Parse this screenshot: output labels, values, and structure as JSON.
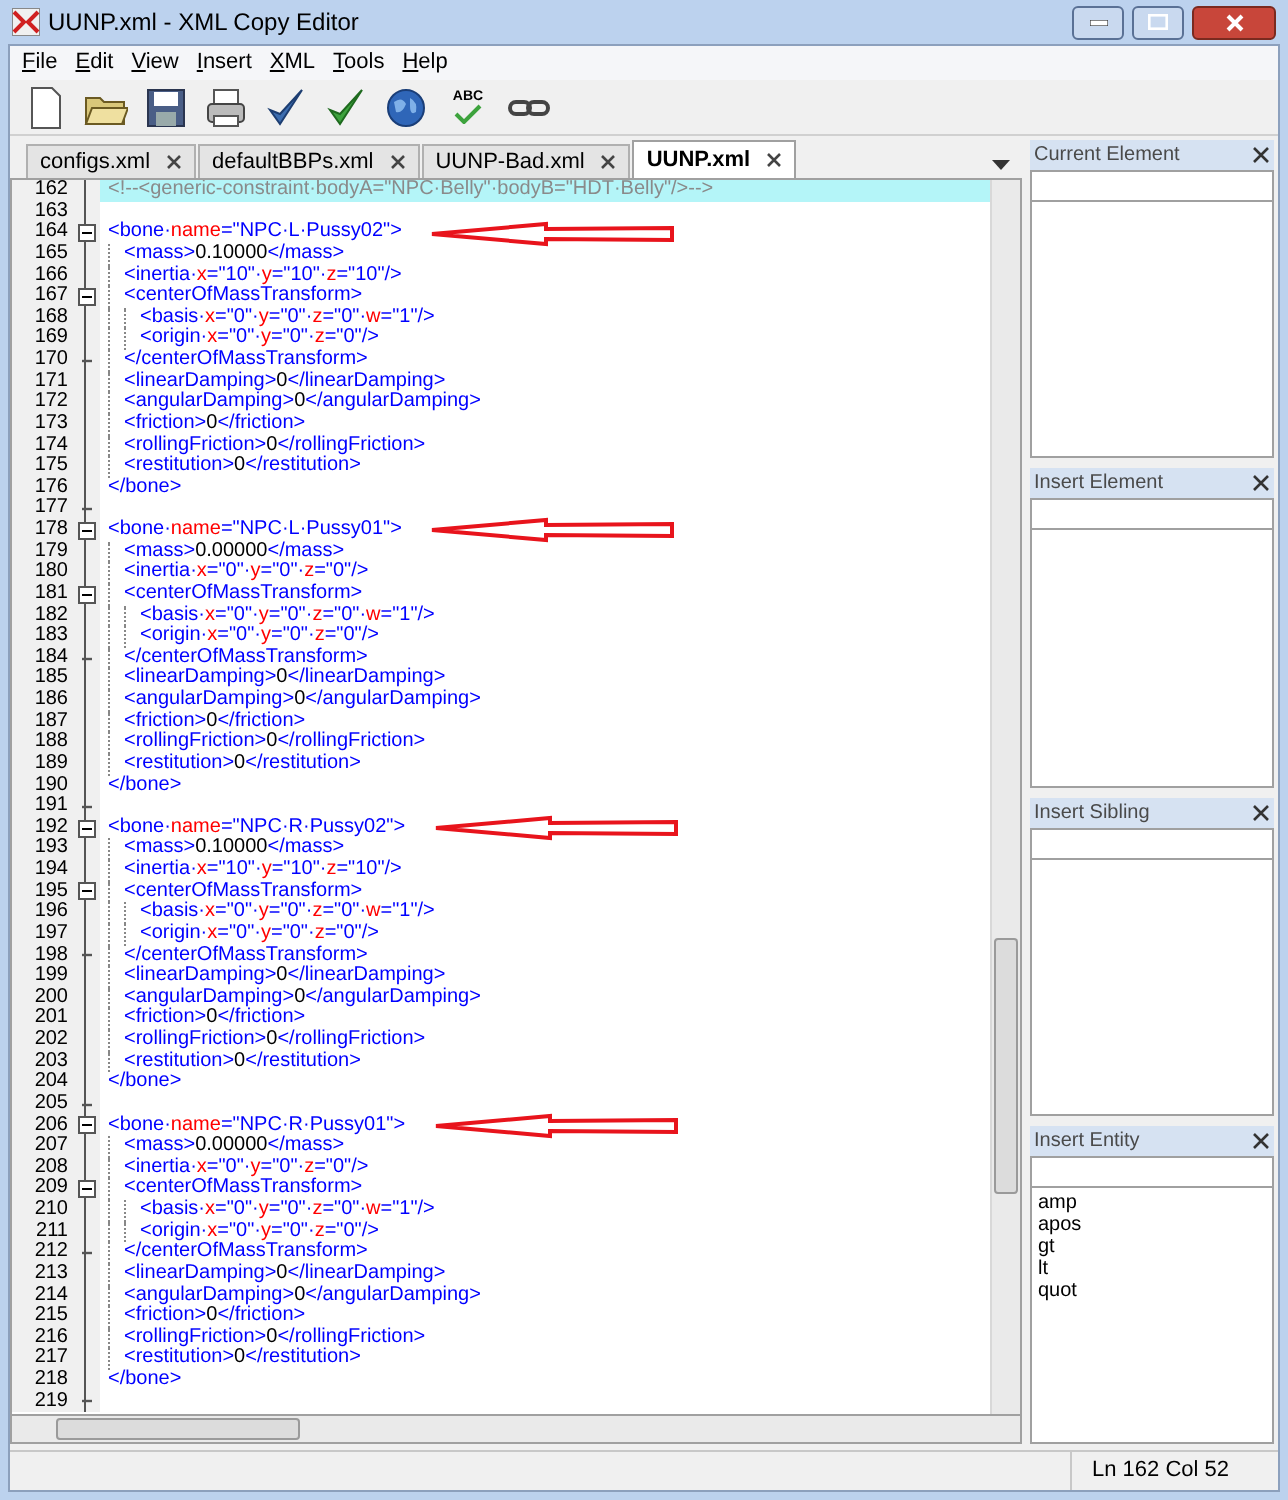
{
  "window": {
    "title": "UUNP.xml - XML Copy Editor"
  },
  "menu": [
    {
      "label": "File"
    },
    {
      "label": "Edit"
    },
    {
      "label": "View"
    },
    {
      "label": "Insert"
    },
    {
      "label": "XML"
    },
    {
      "label": "Tools"
    },
    {
      "label": "Help"
    }
  ],
  "toolbar": [
    {
      "kind": "new"
    },
    {
      "kind": "open"
    },
    {
      "kind": "save"
    },
    {
      "kind": "print"
    },
    {
      "kind": "validate"
    },
    {
      "kind": "wellformed"
    },
    {
      "kind": "globe"
    },
    {
      "kind": "spell",
      "label": "ABC"
    },
    {
      "kind": "link"
    }
  ],
  "tabs": [
    {
      "label": "configs.xml",
      "selected": false
    },
    {
      "label": "defaultBBPs.xml",
      "selected": false
    },
    {
      "label": "UUNP-Bad.xml",
      "selected": false
    },
    {
      "label": "UUNP.xml",
      "selected": true
    }
  ],
  "editor": {
    "lines": [
      {
        "number": "162",
        "text": "<!--<generic-constraint·bodyA=\"NPC·Belly\"·bodyB=\"HDT·Belly\"/>-->",
        "current": true
      },
      {
        "number": "163"
      },
      {
        "number": "164",
        "text": "<bone·name=\"NPC·L·Pussy02\">",
        "foldable": true,
        "arrow": true
      },
      {
        "number": "165",
        "text": "<mass>0.10000</mass>"
      },
      {
        "number": "166",
        "text": "<inertia·x=\"10\"·y=\"10\"·z=\"10\"/>"
      },
      {
        "number": "167",
        "text": "<centerOfMassTransform>",
        "foldable": true
      },
      {
        "number": "168",
        "text": "<basis·x=\"0\"·y=\"0\"·z=\"0\"·w=\"1\"/>"
      },
      {
        "number": "169",
        "text": "<origin·x=\"0\"·y=\"0\"·z=\"0\"/>"
      },
      {
        "number": "170",
        "text": "</centerOfMassTransform>",
        "fold_end": true
      },
      {
        "number": "171",
        "text": "<linearDamping>0</linearDamping>"
      },
      {
        "number": "172",
        "text": "<angularDamping>0</angularDamping>"
      },
      {
        "number": "173",
        "text": "<friction>0</friction>"
      },
      {
        "number": "174",
        "text": "<rollingFriction>0</rollingFriction>"
      },
      {
        "number": "175",
        "text": "<restitution>0</restitution>"
      },
      {
        "number": "176",
        "text": "</bone>"
      },
      {
        "number": "177",
        "fold_end": true
      },
      {
        "number": "178",
        "text": "<bone·name=\"NPC·L·Pussy01\">",
        "foldable": true,
        "arrow": true
      },
      {
        "number": "179",
        "text": "<mass>0.00000</mass>"
      },
      {
        "number": "180",
        "text": "<inertia·x=\"0\"·y=\"0\"·z=\"0\"/>"
      },
      {
        "number": "181",
        "text": "<centerOfMassTransform>",
        "foldable": true
      },
      {
        "number": "182",
        "text": "<basis·x=\"0\"·y=\"0\"·z=\"0\"·w=\"1\"/>"
      },
      {
        "number": "183",
        "text": "<origin·x=\"0\"·y=\"0\"·z=\"0\"/>"
      },
      {
        "number": "184",
        "text": "</centerOfMassTransform>",
        "fold_end": true
      },
      {
        "number": "185",
        "text": "<linearDamping>0</linearDamping>"
      },
      {
        "number": "186",
        "text": "<angularDamping>0</angularDamping>"
      },
      {
        "number": "187",
        "text": "<friction>0</friction>"
      },
      {
        "number": "188",
        "text": "<rollingFriction>0</rollingFriction>"
      },
      {
        "number": "189",
        "text": "<restitution>0</restitution>"
      },
      {
        "number": "190",
        "text": "</bone>"
      },
      {
        "number": "191",
        "fold_end": true
      },
      {
        "number": "192",
        "text": "<bone·name=\"NPC·R·Pussy02\">",
        "foldable": true,
        "arrow": true
      },
      {
        "number": "193",
        "text": "<mass>0.10000</mass>"
      },
      {
        "number": "194",
        "text": "<inertia·x=\"10\"·y=\"10\"·z=\"10\"/>"
      },
      {
        "number": "195",
        "text": "<centerOfMassTransform>",
        "foldable": true
      },
      {
        "number": "196",
        "text": "<basis·x=\"0\"·y=\"0\"·z=\"0\"·w=\"1\"/>"
      },
      {
        "number": "197",
        "text": "<origin·x=\"0\"·y=\"0\"·z=\"0\"/>"
      },
      {
        "number": "198",
        "text": "</centerOfMassTransform>",
        "fold_end": true
      },
      {
        "number": "199",
        "text": "<linearDamping>0</linearDamping>"
      },
      {
        "number": "200",
        "text": "<angularDamping>0</angularDamping>"
      },
      {
        "number": "201",
        "text": "<friction>0</friction>"
      },
      {
        "number": "202",
        "text": "<rollingFriction>0</rollingFriction>"
      },
      {
        "number": "203",
        "text": "<restitution>0</restitution>"
      },
      {
        "number": "204",
        "text": "</bone>"
      },
      {
        "number": "205",
        "fold_end": true
      },
      {
        "number": "206",
        "text": "<bone·name=\"NPC·R·Pussy01\">",
        "foldable": true,
        "arrow": true
      },
      {
        "number": "207",
        "text": "<mass>0.00000</mass>"
      },
      {
        "number": "208",
        "text": "<inertia·x=\"0\"·y=\"0\"·z=\"0\"/>"
      },
      {
        "number": "209",
        "text": "<centerOfMassTransform>",
        "foldable": true
      },
      {
        "number": "210",
        "text": "<basis·x=\"0\"·y=\"0\"·z=\"0\"·w=\"1\"/>"
      },
      {
        "number": "211",
        "text": "<origin·x=\"0\"·y=\"0\"·z=\"0\"/>"
      },
      {
        "number": "212",
        "text": "</centerOfMassTransform>",
        "fold_end": true
      },
      {
        "number": "213",
        "text": "<linearDamping>0</linearDamping>"
      },
      {
        "number": "214",
        "text": "<angularDamping>0</angularDamping>"
      },
      {
        "number": "215",
        "text": "<friction>0</friction>"
      },
      {
        "number": "216",
        "text": "<rollingFriction>0</rollingFriction>"
      },
      {
        "number": "217",
        "text": "<restitution>0</restitution>"
      },
      {
        "number": "218",
        "text": "</bone>"
      },
      {
        "number": "219",
        "fold_end": true
      }
    ]
  },
  "panels": [
    {
      "title": "Current Element"
    },
    {
      "title": "Insert Element"
    },
    {
      "title": "Insert Sibling"
    },
    {
      "title": "Insert Entity",
      "items": [
        "amp",
        "apos",
        "gt",
        "lt",
        "quot"
      ]
    }
  ],
  "status_bar": {
    "position": "Ln 162 Col 52"
  }
}
